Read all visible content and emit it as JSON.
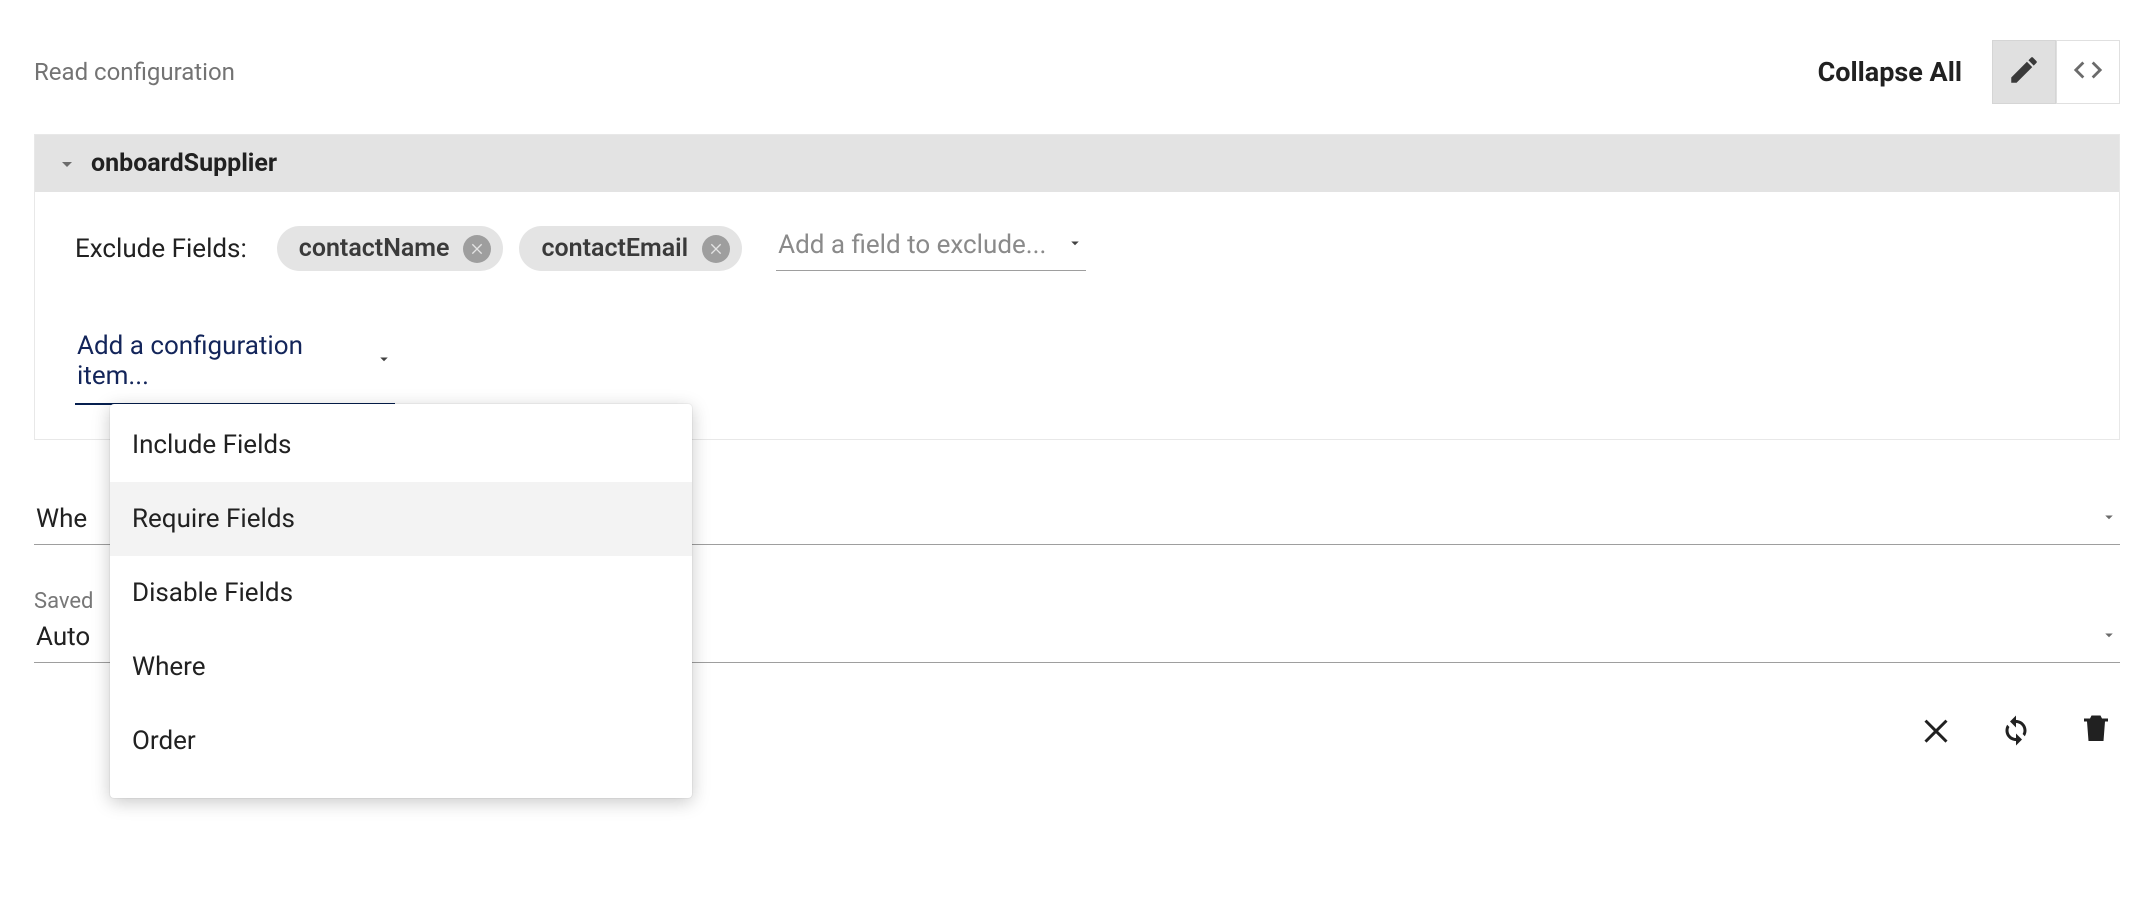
{
  "top": {
    "label": "Read configuration",
    "collapse_all": "Collapse All"
  },
  "panel": {
    "title": "onboardSupplier"
  },
  "exclude": {
    "label": "Exclude Fields:",
    "chips": [
      "contactName",
      "contactEmail"
    ],
    "add_placeholder": "Add a field to exclude..."
  },
  "config_select": {
    "text": "Add a configuration item..."
  },
  "dropdown": {
    "items": [
      "Include Fields",
      "Require Fields",
      "Disable Fields",
      "Where",
      "Order"
    ],
    "hovered_index": 1
  },
  "where_field": {
    "label_fragment": "Whe"
  },
  "saved_views": {
    "label_fragment": "Saved",
    "value_fragment": "Auto"
  }
}
